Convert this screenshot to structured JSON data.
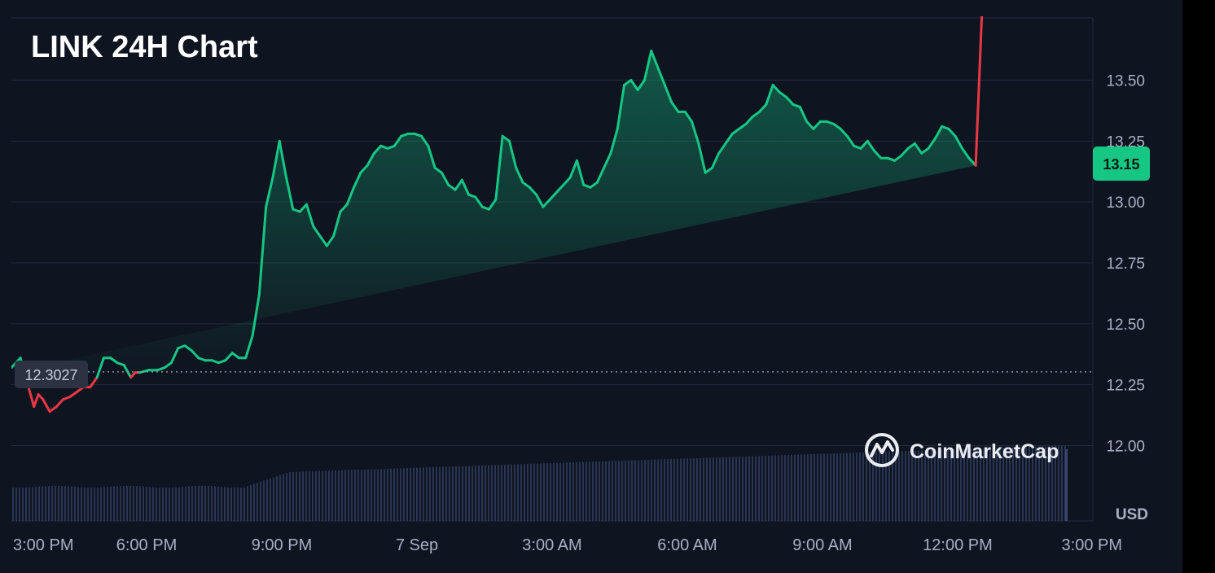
{
  "chart_data": {
    "type": "area",
    "title": "LINK 24H Chart",
    "unit_label": "USD",
    "current_price_badge": "13.15",
    "reference_label": "12.3027",
    "reference_value": 12.3027,
    "watermark": "CoinMarketCap",
    "ylim": [
      12.0,
      13.75
    ],
    "yticks": [
      "13.50",
      "13.25",
      "13.00",
      "12.75",
      "12.50",
      "12.25",
      "12.00"
    ],
    "ytick_values": [
      13.5,
      13.25,
      13.0,
      12.75,
      12.5,
      12.25,
      12.0
    ],
    "xticks": [
      "3:00 PM",
      "6:00 PM",
      "9:00 PM",
      "7 Sep",
      "3:00 AM",
      "6:00 AM",
      "9:00 AM",
      "12:00 PM",
      "3:00 PM"
    ],
    "xtick_hours": [
      0,
      2.25,
      5.25,
      8.25,
      11.25,
      14.25,
      17.25,
      20.25,
      23.3
    ],
    "x_hours_range": [
      -0.75,
      23.25
    ],
    "grid": true,
    "colors": {
      "up": "#16c784",
      "down": "#ea3943",
      "badge": "#16c784",
      "volume": "#2a3553",
      "grid": "#232a3b",
      "axis_text": "#a9b0c2"
    },
    "series": [
      {
        "x_hours": [
          -0.75,
          -0.55,
          -0.4,
          -0.25,
          -0.15,
          -0.05,
          0.1,
          0.25,
          0.4,
          0.55,
          0.7,
          0.85,
          1.0,
          1.15,
          1.3,
          1.45,
          1.6,
          1.75,
          1.9,
          2.0,
          2.1,
          2.3,
          2.5,
          2.65,
          2.8,
          2.95,
          3.1,
          3.25,
          3.4,
          3.55,
          3.7,
          3.85,
          4.0,
          4.15,
          4.3,
          4.45,
          4.6,
          4.75,
          4.9,
          5.05,
          5.2,
          5.35,
          5.5,
          5.65,
          5.8,
          5.95,
          6.1,
          6.25,
          6.4,
          6.55,
          6.7,
          6.85,
          7.0,
          7.15,
          7.3,
          7.45,
          7.6,
          7.75,
          7.9,
          8.05,
          8.2,
          8.35,
          8.5,
          8.65,
          8.8,
          8.95,
          9.1,
          9.25,
          9.4,
          9.55,
          9.7,
          9.85,
          10.0,
          10.15,
          10.3,
          10.45,
          10.6,
          10.75,
          10.9,
          11.05,
          11.2,
          11.35,
          11.5,
          11.65,
          11.8,
          11.95,
          12.1,
          12.25,
          12.4,
          12.55,
          12.7,
          12.85,
          13.0,
          13.15,
          13.3,
          13.45,
          13.6,
          13.75,
          13.9,
          14.05,
          14.2,
          14.35,
          14.5,
          14.65,
          14.8,
          14.95,
          15.1,
          15.25,
          15.4,
          15.55,
          15.7,
          15.85,
          16.0,
          16.15,
          16.3,
          16.45,
          16.6,
          16.75,
          16.9,
          17.05,
          17.2,
          17.35,
          17.5,
          17.65,
          17.8,
          17.95,
          18.1,
          18.25,
          18.4,
          18.55,
          18.7,
          18.85,
          19.0,
          19.15,
          19.3,
          19.45,
          19.6,
          19.75,
          19.9,
          20.05,
          20.2,
          20.35,
          20.5,
          20.65,
          20.8,
          20.95,
          21.1,
          21.25,
          21.4,
          21.55,
          21.7,
          21.85,
          22.0,
          22.15,
          22.3,
          22.45,
          22.6,
          22.75,
          22.9,
          23.05,
          23.25
        ],
        "values": [
          12.32,
          12.36,
          12.26,
          12.16,
          12.21,
          12.19,
          12.14,
          12.16,
          12.19,
          12.2,
          12.22,
          12.24,
          12.24,
          12.28,
          12.36,
          12.36,
          12.34,
          12.33,
          12.28,
          12.3,
          12.3,
          12.31,
          12.31,
          12.32,
          12.34,
          12.4,
          12.41,
          12.39,
          12.36,
          12.35,
          12.35,
          12.34,
          12.35,
          12.38,
          12.36,
          12.36,
          12.45,
          12.62,
          12.98,
          13.1,
          13.25,
          13.1,
          12.97,
          12.96,
          12.99,
          12.9,
          12.86,
          12.82,
          12.86,
          12.96,
          12.99,
          13.06,
          13.12,
          13.15,
          13.2,
          13.23,
          13.22,
          13.23,
          13.27,
          13.28,
          13.28,
          13.27,
          13.23,
          13.14,
          13.12,
          13.07,
          13.05,
          13.09,
          13.03,
          13.02,
          12.98,
          12.97,
          13.01,
          13.27,
          13.25,
          13.14,
          13.08,
          13.06,
          13.03,
          12.98,
          13.01,
          13.04,
          13.07,
          13.1,
          13.17,
          13.07,
          13.06,
          13.08,
          13.14,
          13.2,
          13.3,
          13.48,
          13.5,
          13.46,
          13.5,
          13.62,
          13.55,
          13.48,
          13.41,
          13.37,
          13.37,
          13.33,
          13.24,
          13.12,
          13.14,
          13.2,
          13.24,
          13.28,
          13.3,
          13.32,
          13.35,
          13.37,
          13.4,
          13.48,
          13.45,
          13.43,
          13.4,
          13.39,
          13.33,
          13.3,
          13.33,
          13.33,
          13.32,
          13.3,
          13.27,
          13.23,
          13.22,
          13.25,
          13.21,
          13.18,
          13.18,
          13.17,
          13.19,
          13.22,
          13.24,
          13.2,
          13.22,
          13.26,
          13.31,
          13.3,
          13.27,
          13.22,
          13.18,
          13.15
        ]
      }
    ],
    "volume_relative": "rises from low before 9:00 PM to higher values after"
  }
}
